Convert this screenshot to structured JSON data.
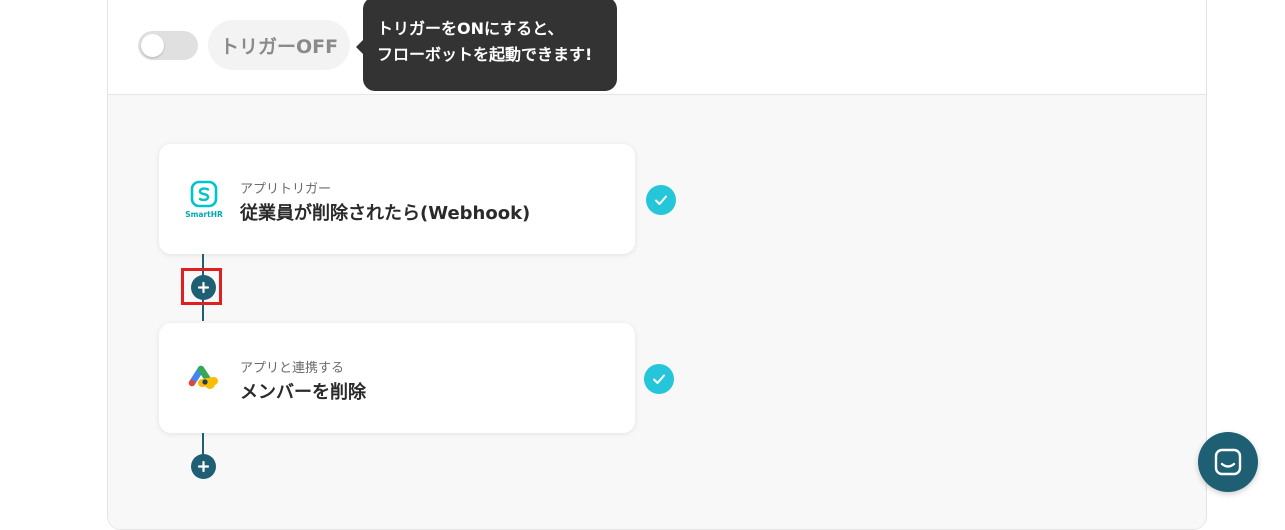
{
  "trigger": {
    "status_label": "トリガーOFF",
    "tooltip_line1": "トリガーをONにすると、",
    "tooltip_line2": "フローボットを起動できます!"
  },
  "steps": [
    {
      "subtitle": "アプリトリガー",
      "title": "従業員が削除されたら(Webhook)",
      "app_icon": "smarthr-logo",
      "app_name": "SmartHR",
      "status_icon": "check-icon"
    },
    {
      "subtitle": "アプリと連携する",
      "title": "メンバーを削除",
      "app_icon": "google-workspace-logo",
      "status_icon": "check-icon"
    }
  ],
  "colors": {
    "accent": "#1e5f74",
    "check": "#26c6da",
    "highlight": "#e02020",
    "smarthr": "#00c4cc"
  },
  "icons": {
    "add": "plus-icon",
    "chat": "chat-icon"
  }
}
